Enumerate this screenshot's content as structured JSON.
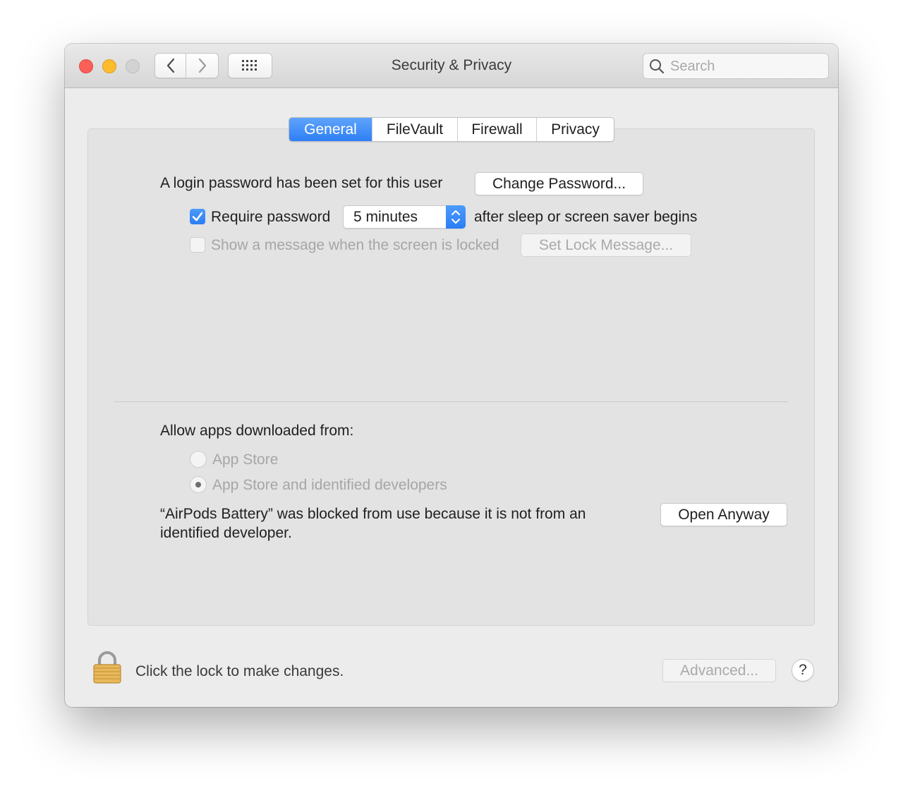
{
  "window": {
    "title": "Security & Privacy"
  },
  "toolbar": {
    "back_icon": "chevron-left-icon",
    "forward_icon": "chevron-right-icon",
    "grid_icon": "grid-icon",
    "search_placeholder": "Search",
    "search_value": ""
  },
  "tabs": [
    {
      "label": "General",
      "active": true
    },
    {
      "label": "FileVault",
      "active": false
    },
    {
      "label": "Firewall",
      "active": false
    },
    {
      "label": "Privacy",
      "active": false
    }
  ],
  "general": {
    "login_text": "A login password has been set for this user",
    "change_password_label": "Change Password...",
    "require_password_label": "Require password",
    "require_password_checked": true,
    "require_password_delay": "5 minutes",
    "after_sleep_text": "after sleep or screen saver begins",
    "show_message_label": "Show a message when the screen is locked",
    "show_message_checked": false,
    "set_lock_message_label": "Set Lock Message..."
  },
  "allow_apps": {
    "heading": "Allow apps downloaded from:",
    "options": [
      {
        "label": "App Store",
        "selected": false
      },
      {
        "label": "App Store and identified developers",
        "selected": true
      }
    ],
    "blocked_line1": "“AirPods Battery” was blocked from use because it is not from an",
    "blocked_line2": "identified developer.",
    "open_anyway_label": "Open Anyway"
  },
  "footer": {
    "lock_text": "Click the lock to make changes.",
    "advanced_label": "Advanced...",
    "help_label": "?"
  },
  "colors": {
    "accent": "#2f7ff5",
    "close": "#fc5f57",
    "minimize": "#fdbc2e",
    "zoom_disabled": "#d2d2d2"
  }
}
